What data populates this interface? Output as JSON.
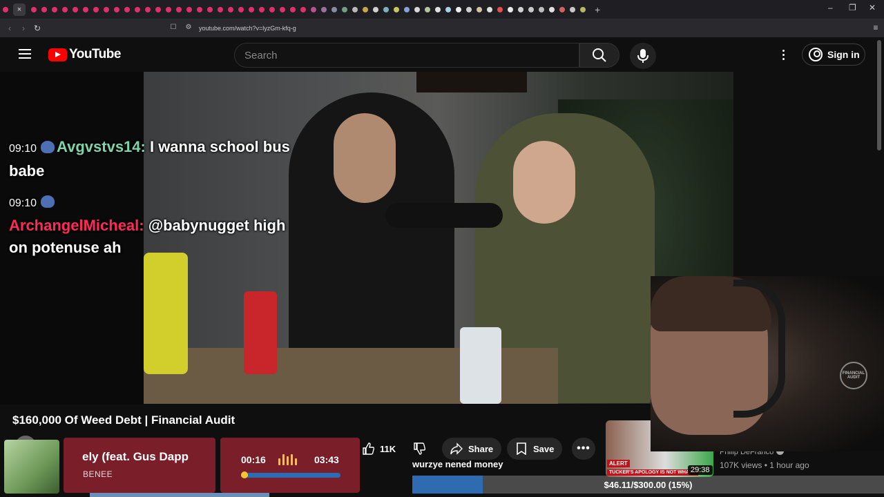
{
  "browser": {
    "url": "youtube.com/watch?v=lyzGm-kfq-g",
    "tab_close": "×",
    "new_tab": "+",
    "win_minimize": "–",
    "win_restore": "❐",
    "win_close": "✕"
  },
  "header": {
    "logo_text": "YouTube",
    "search_placeholder": "Search",
    "sign_in": "Sign in"
  },
  "chat": {
    "msg1": {
      "time": "09:10",
      "user": "Avgvstvs14:",
      "text": " I wanna school bus babe"
    },
    "msg2": {
      "time": "09:10",
      "user": "ArchangelMicheal:",
      "text": " @babynugget high on potenuse ah"
    }
  },
  "video": {
    "title": "$160,000 Of Weed Debt | Financial Audit",
    "likes": "11K",
    "share_label": "Share",
    "save_label": "Save",
    "webcam_logo": "FINANCIAL AUDIT"
  },
  "music": {
    "title": "ely (feat. Gus Dapp",
    "artist": "BENEE",
    "elapsed": "00:16",
    "total": "03:43",
    "progress": 0.07
  },
  "donation": {
    "message": "wurzye nened money",
    "goal_text": "$46.11/$300.00 (15%)",
    "progress": 0.15
  },
  "recommended": {
    "alert": "ALERT",
    "caption": "TUCKER'S APOLOGY IS NOT WHAT Y",
    "duration": "29:38",
    "channel": "Philip DeFranco",
    "meta": "107K views • 1 hour ago"
  },
  "colors": {
    "youtube_red": "#ff0000",
    "chat_user1": "#7ed4a8",
    "chat_user2": "#ff2a5a",
    "music_box": "#7a1f2a",
    "goal_fill": "#2f6bb0"
  }
}
